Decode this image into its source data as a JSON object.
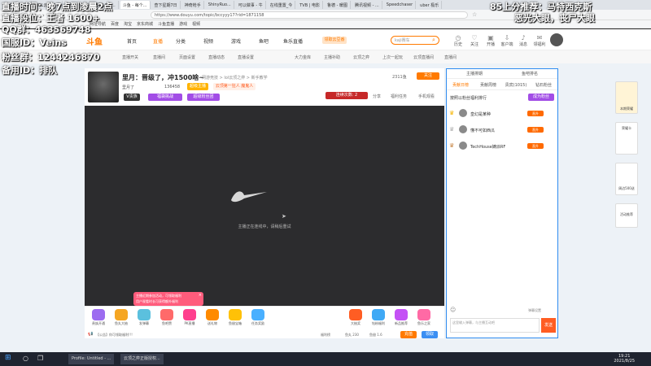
{
  "browser": {
    "tabs": [
      "《云顶之弈》",
      "LOL云顶之...",
      "百度一下...",
      "赛制LOL-...",
      "斗鱼 - 每个...",
      "查下星期7日",
      "神奇枪手",
      "ShinyRuo...",
      "可以做事 - 牛",
      "在线重置_今",
      "TVB | 电影",
      "鲁德 - 暖图",
      "腾讯视频 - ...",
      "Speedchaser",
      "uber 极乐"
    ],
    "url": "https://www.douyu.com/topic/bccyyy17?rid=1871158",
    "bookmarks": [
      "网址导航",
      "百度",
      "淘宝",
      "京东商城",
      "斗鱼直播",
      "游戏",
      "视频"
    ]
  },
  "header": {
    "logo": "斗鱼",
    "nav": [
      "首页",
      "直播",
      "分类",
      "视频",
      "游戏",
      "鱼吧",
      "鱼乐直播"
    ],
    "search_placeholder": "kaji赛车",
    "icons": [
      {
        "label": "历史",
        "icon": "clock-icon"
      },
      {
        "label": "关注",
        "icon": "heart-icon"
      },
      {
        "label": "开播",
        "icon": "camera-icon"
      },
      {
        "label": "客户端",
        "icon": "download-icon"
      },
      {
        "label": "消息",
        "icon": "bell-icon"
      },
      {
        "label": "领福利",
        "icon": "gift-icon"
      }
    ],
    "promo": "领取云豆番"
  },
  "subnav": [
    "直播开关",
    "直播间",
    "页面设置",
    "直播动态",
    "直播设置",
    "大力金库",
    "主播补助",
    "云顶之弈",
    "上次一起玩",
    "云顶直播间",
    "直播间"
  ],
  "room": {
    "title": "排名",
    "subtitle": "里月：晋级了，冲1500啥~",
    "category": "网游竞技 > lol云顶之弈 > 新手教学",
    "anchor": "里月了",
    "fans": "136458",
    "badge": "超级主播",
    "tag1": "云顶第一狂人 魔鬼人",
    "vip_label": "V贵族",
    "activity1": "福袋挑战",
    "activity2": "超级粉丝团",
    "stats": [
      "2311鱼",
      "关注"
    ],
    "share": "分享",
    "report": "福利任务",
    "mobile": "手机观看",
    "combo": "连续次数: 2",
    "video_message": "主播正在连线中，请稍后重试"
  },
  "toolbar": {
    "items": [
      "贵族开通",
      "鱼丸大抽",
      "发弹幕",
      "鱼吧赞",
      "PK直播",
      "送礼物",
      "鱼翅宝箱",
      "任务奖励",
      "大抽奖",
      "钻粉福利",
      "新品推荐",
      "鱼乐之家"
    ],
    "notice": "主播近期参加活动，可领取福利",
    "notice_sub": "用户观看时长可获得额外福利",
    "announcement": "【公告】你可领取福利!!!",
    "rank_label": "福利榜",
    "fans_count": "鱼丸 230",
    "fish_count": "鱼翅 1.6",
    "recharge": "充值",
    "dance": "领取"
  },
  "chat": {
    "tabs": [
      "主播排期",
      "鱼吧排名"
    ],
    "subtabs": [
      "贡献日榜",
      "贡献周榜",
      "贵宾(1015)",
      "钻石粉丝"
    ],
    "rank_title": "按照以粉丝福利排行",
    "join_label": "成为粉丝",
    "rank_rows": [
      {
        "name": "皇幻是某种",
        "badge": "直升"
      },
      {
        "name": "懂不可如西瓜",
        "badge": "直升"
      },
      {
        "name": "TechHouse嫡派RF",
        "badge": "直升"
      }
    ],
    "input_placeholder": "这里输入弹幕，与主播互动吧",
    "send": "发送",
    "tools": "弹幕设置"
  },
  "rail": {
    "card1": "本期荣耀",
    "card2": "荣耀卡",
    "card3": "周边500送",
    "card4": "活动推荐"
  },
  "overlay": {
    "lines": [
      "直播时间：晚7点到凌晨2点",
      "直播段位：王者 1600+",
      "QQ群：463569748",
      "国服ID：Veins",
      "粉丝群：1244246870",
      "备用ID：排队"
    ],
    "right_line1": "85上分推荐：马特西克斯",
    "right_line2": "恶光大眼，丧尸大眼"
  },
  "taskbar": {
    "tasks": [
      "Profile: Untitled - ...",
      "云顶之弈正版授权..."
    ],
    "time": "19:21",
    "date": "2021/8/25"
  }
}
